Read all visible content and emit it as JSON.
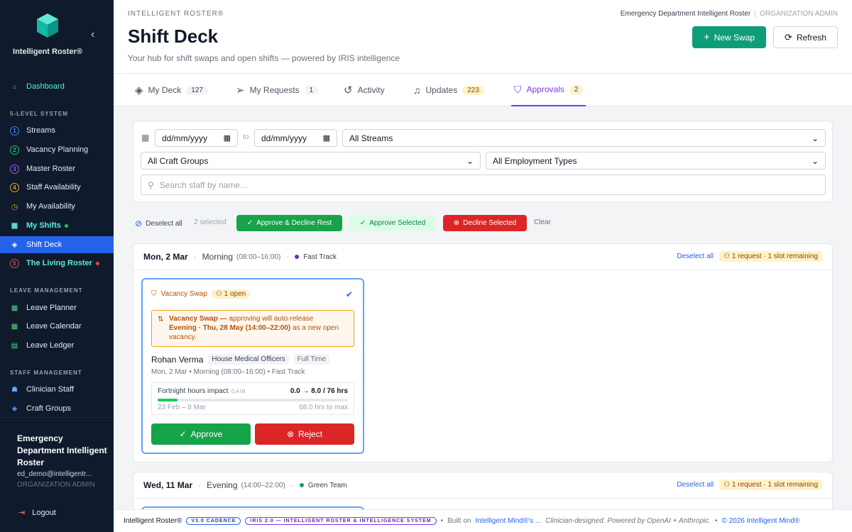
{
  "sidebar": {
    "brand": "Intelligent Roster®",
    "collapse_icon": "chevron-left-icon",
    "dashboard": "Dashboard",
    "section_levels": "5-LEVEL SYSTEM",
    "levels": [
      {
        "num": "1",
        "label": "Streams",
        "color": "#3b82f6"
      },
      {
        "num": "2",
        "label": "Vacancy Planning",
        "color": "#22c55e"
      },
      {
        "num": "3",
        "label": "Master Roster",
        "color": "#a855f7"
      },
      {
        "num": "4",
        "label": "Staff Availability",
        "color": "#f59e0b"
      }
    ],
    "my_availability": "My Availability",
    "my_shifts": "My Shifts",
    "shift_deck": "Shift Deck",
    "living_roster": "The Living Roster",
    "living_num": "5",
    "section_leave": "LEAVE MANAGEMENT",
    "leave_items": [
      "Leave Planner",
      "Leave Calendar",
      "Leave Ledger"
    ],
    "section_staff": "STAFF MANAGEMENT",
    "staff_items": [
      "Clinician Staff",
      "Craft Groups"
    ],
    "user": {
      "name": "Emergency Department Intelligent Roster",
      "email": "ed_demo@intelligentr...",
      "role": "ORGANIZATION ADMIN"
    },
    "logout": "Logout"
  },
  "header": {
    "small_brand": "INTELLIGENT ROSTER®",
    "title": "Shift Deck",
    "subtitle": "Your hub for shift swaps and open shifts — powered by IRIS intelligence",
    "org_name": "Emergency Department Intelligent Roster",
    "org_role": "ORGANIZATION ADMIN",
    "new_swap": "New Swap",
    "refresh": "Refresh"
  },
  "tabs": [
    {
      "label": "My Deck",
      "badge": "127"
    },
    {
      "label": "My Requests",
      "badge": "1"
    },
    {
      "label": "Activity",
      "badge": ""
    },
    {
      "label": "Updates",
      "badge": "223"
    },
    {
      "label": "Approvals",
      "badge": "2"
    }
  ],
  "filters": {
    "date_from": "dd/mm/yyyy",
    "to": "to",
    "date_to": "dd/mm/yyyy",
    "stream": "All Streams",
    "craft": "All Craft Groups",
    "employment": "All Employment Types",
    "search_placeholder": "Search staff by name..."
  },
  "actions": {
    "deselect_all": "Deselect all",
    "selected": "2 selected",
    "approve_decline": "Approve & Decline Rest",
    "approve_selected": "Approve Selected",
    "decline_selected": "Decline Selected",
    "clear": "Clear"
  },
  "groups": [
    {
      "date": "Mon, 2 Mar",
      "shift": "Morning",
      "time": "(08:00–16:00)",
      "team": "Fast Track",
      "team_color": "#6d28d9",
      "deselect": "Deselect all",
      "request": "1 request · 1 slot remaining",
      "card": {
        "type": "Vacancy Swap",
        "open": "1 open",
        "note_bold": "Vacancy Swap —",
        "note_rest": " approving will auto-release",
        "note_bold2": "Evening · Thu, 28 May (14:00–22:00)",
        "note_rest2": " as a new open vacancy.",
        "name": "Rohan Verma",
        "craft": "House Medical Officers",
        "employment": "Full Time",
        "meta": "Mon, 2 Mar • Morning (08:00–16:00) • Fast Track",
        "impact_label": "Fortnight hours impact",
        "impact_tag": "GAIN",
        "impact_value": "0.0 → 8.0 / 76 hrs",
        "impact_fraction": 0.105,
        "period": "23 Feb – 8 Mar",
        "to_max": "68.0 hrs to max",
        "approve": "Approve",
        "reject": "Reject"
      }
    },
    {
      "date": "Wed, 11 Mar",
      "shift": "Evening",
      "time": "(14:00–22:00)",
      "team": "Green Team",
      "team_color": "#16a34a",
      "deselect": "Deselect all",
      "request": "1 request · 1 slot remaining"
    }
  ],
  "footer": {
    "brand": "Intelligent Roster®",
    "pill1": "V3.0 CADENCE",
    "pill2": "IRIS 2.0 — INTELLIGENT ROSTER & INTELLIGENCE SYSTEM",
    "built_on": "Built on",
    "mind": "Intelligent Mind®'s ...",
    "designed": "Clinician-designed. Powered by OpenAI + Anthropic.",
    "copyright": "© 2026 Intelligent Mind®"
  }
}
